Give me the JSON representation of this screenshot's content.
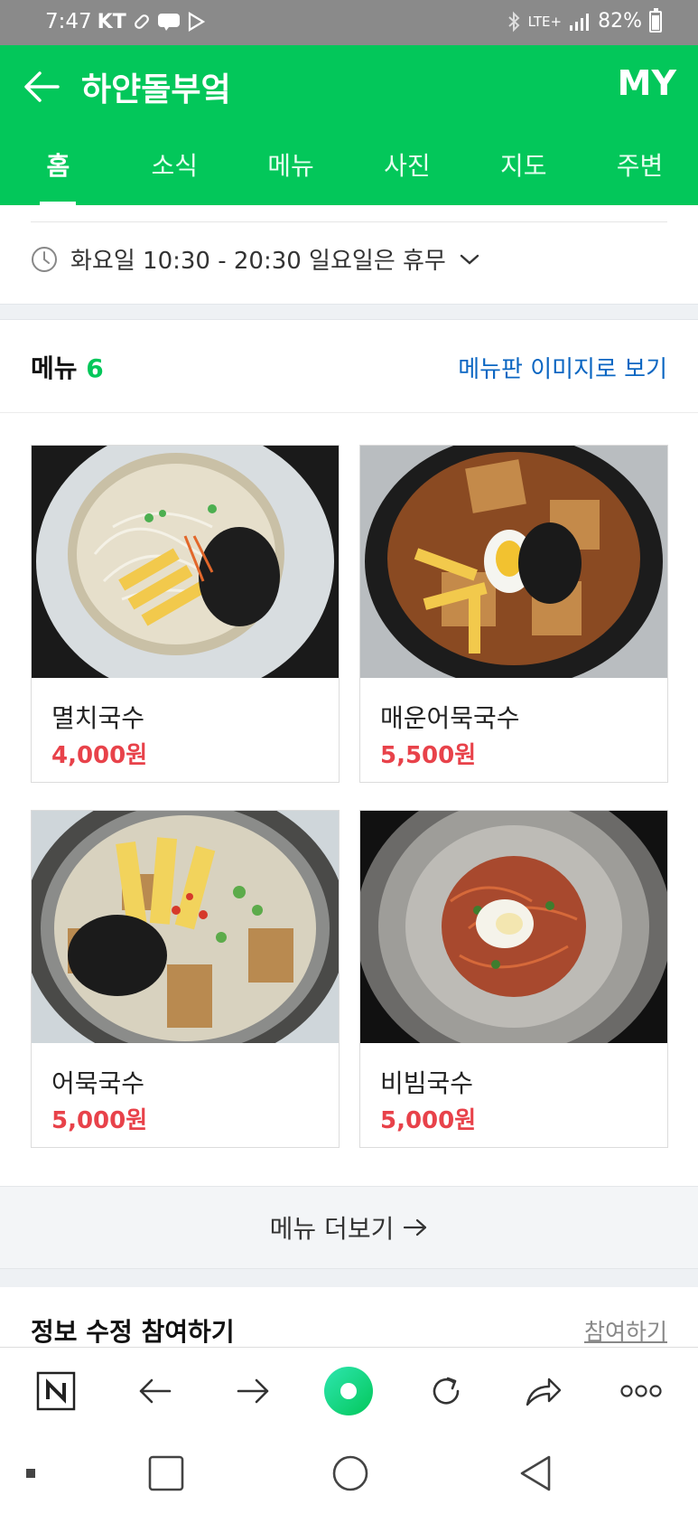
{
  "status_bar": {
    "time": "7:47",
    "carrier": "KT",
    "network": "LTE+",
    "battery": "82%"
  },
  "header": {
    "title": "하얀돌부엌",
    "my_label": "MY"
  },
  "tabs": [
    {
      "label": "홈",
      "active": true
    },
    {
      "label": "소식",
      "active": false
    },
    {
      "label": "메뉴",
      "active": false
    },
    {
      "label": "사진",
      "active": false
    },
    {
      "label": "지도",
      "active": false
    },
    {
      "label": "주변",
      "active": false
    }
  ],
  "hours": {
    "text": "화요일 10:30 - 20:30 일요일은 휴무"
  },
  "menu_section": {
    "title": "메뉴",
    "count": "6",
    "board_link": "메뉴판 이미지로 보기",
    "items": [
      {
        "name": "멸치국수",
        "price": "4,000원"
      },
      {
        "name": "매운어묵국수",
        "price": "5,500원"
      },
      {
        "name": "어묵국수",
        "price": "5,000원"
      },
      {
        "name": "비빔국수",
        "price": "5,000원"
      }
    ],
    "more_label": "메뉴 더보기"
  },
  "info_section": {
    "title": "정보 수정 참여하기",
    "link": "참여하기"
  },
  "colors": {
    "brand_green": "#03c75a",
    "price_red": "#e8424a",
    "link_blue": "#0b66c2"
  },
  "icons": {
    "browser_bar": [
      "naver-n-icon",
      "back-arrow-icon",
      "forward-arrow-icon",
      "green-dot-icon",
      "refresh-icon",
      "share-icon",
      "more-dots-icon"
    ],
    "nav_bar": [
      "recent-apps-icon",
      "home-circle-icon",
      "back-triangle-icon"
    ]
  }
}
